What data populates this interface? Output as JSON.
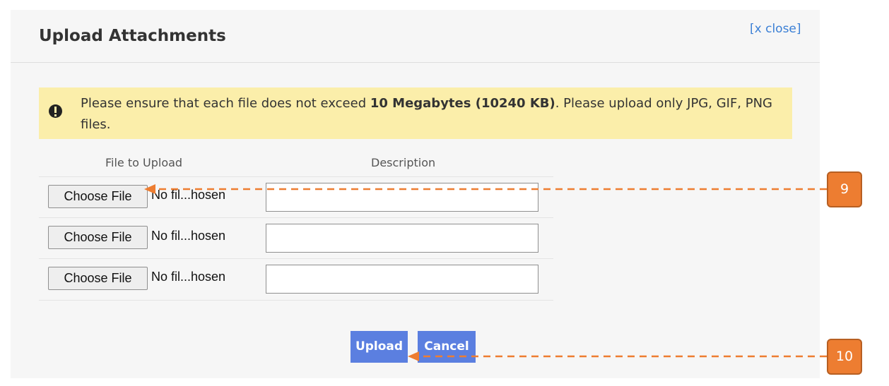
{
  "dialog": {
    "title": "Upload Attachments",
    "close_label": "[x close]"
  },
  "notice": {
    "text_before": "Please ensure that each file does not exceed ",
    "text_bold": "10 Megabytes (10240 KB)",
    "text_after": ". Please upload only JPG, GIF, PNG files."
  },
  "table": {
    "headers": [
      "File to Upload",
      "Description"
    ],
    "rows": [
      {
        "button_label": "Choose File",
        "file_status": "No fil...hosen",
        "description": ""
      },
      {
        "button_label": "Choose File",
        "file_status": "No fil...hosen",
        "description": ""
      },
      {
        "button_label": "Choose File",
        "file_status": "No fil...hosen",
        "description": ""
      }
    ]
  },
  "actions": {
    "upload_label": "Upload",
    "cancel_label": "Cancel"
  },
  "annotations": {
    "callout_1": "9",
    "callout_2": "10",
    "color": "#ed7d31"
  }
}
